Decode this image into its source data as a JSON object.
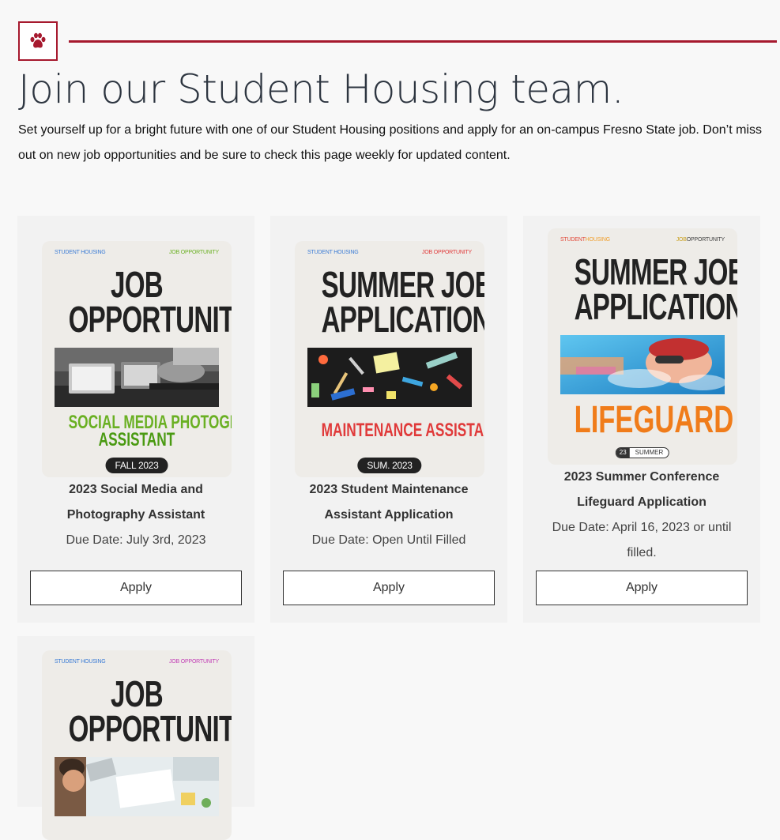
{
  "header": {
    "logo_icon": "paw-icon",
    "accent_color": "#a6192e",
    "title": "Join our Student Housing team.",
    "intro": "Set yourself up for a bright future with one of our Student Housing positions and apply for an on-campus Fresno State job. Don’t miss out on new job opportunities and be sure to check this page weekly for updated content."
  },
  "jobs": [
    {
      "poster": {
        "left_tag": "STUDENT HOUSING",
        "right_tag": "JOB OPPORTUNITY",
        "headline_1": "JOB",
        "headline_2": "OPPORTUNITY",
        "subtitle_1": "SOCIAL MEDIA PHOTOGRAPHY",
        "subtitle_2": "ASSISTANT",
        "pill": "FALL 2023"
      },
      "title_line_1": "2023 Social Media and",
      "title_line_2": "Photography Assistant",
      "due": "Due Date: July 3rd, 2023",
      "apply_label": "Apply"
    },
    {
      "poster": {
        "left_tag": "STUDENT HOUSING",
        "right_tag": "JOB OPPORTUNITY",
        "headline_1": "SUMMER JOB",
        "headline_2": "APPLICATIONS",
        "subtitle_1": "MAINTENANCE ASSISTANT",
        "pill": "SUM. 2023"
      },
      "title_line_1": "2023 Student Maintenance",
      "title_line_2": "Assistant Application",
      "due": "Due Date: Open Until Filled",
      "apply_label": "Apply"
    },
    {
      "poster": {
        "left_tag_a": "STUDENT",
        "left_tag_b": "HOUSING",
        "right_tag_a": "JOB",
        "right_tag_b": "OPPORTUNITY",
        "headline_1": "SUMMER JOBS",
        "headline_2": "APPLICATIONS",
        "subtitle_1": "LIFEGUARD",
        "pill_num": "23",
        "pill": "SUMMER"
      },
      "title_line_1": "2023 Summer Conference",
      "title_line_2": "Lifeguard Application",
      "due_line_1": "Due Date: April 16, 2023 or until",
      "due_line_2": "filled.",
      "apply_label": "Apply"
    },
    {
      "poster": {
        "left_tag": "STUDENT HOUSING",
        "right_tag": "JOB OPPORTUNITY",
        "headline_1": "JOB",
        "headline_2": "OPPORTUNITY"
      }
    }
  ]
}
